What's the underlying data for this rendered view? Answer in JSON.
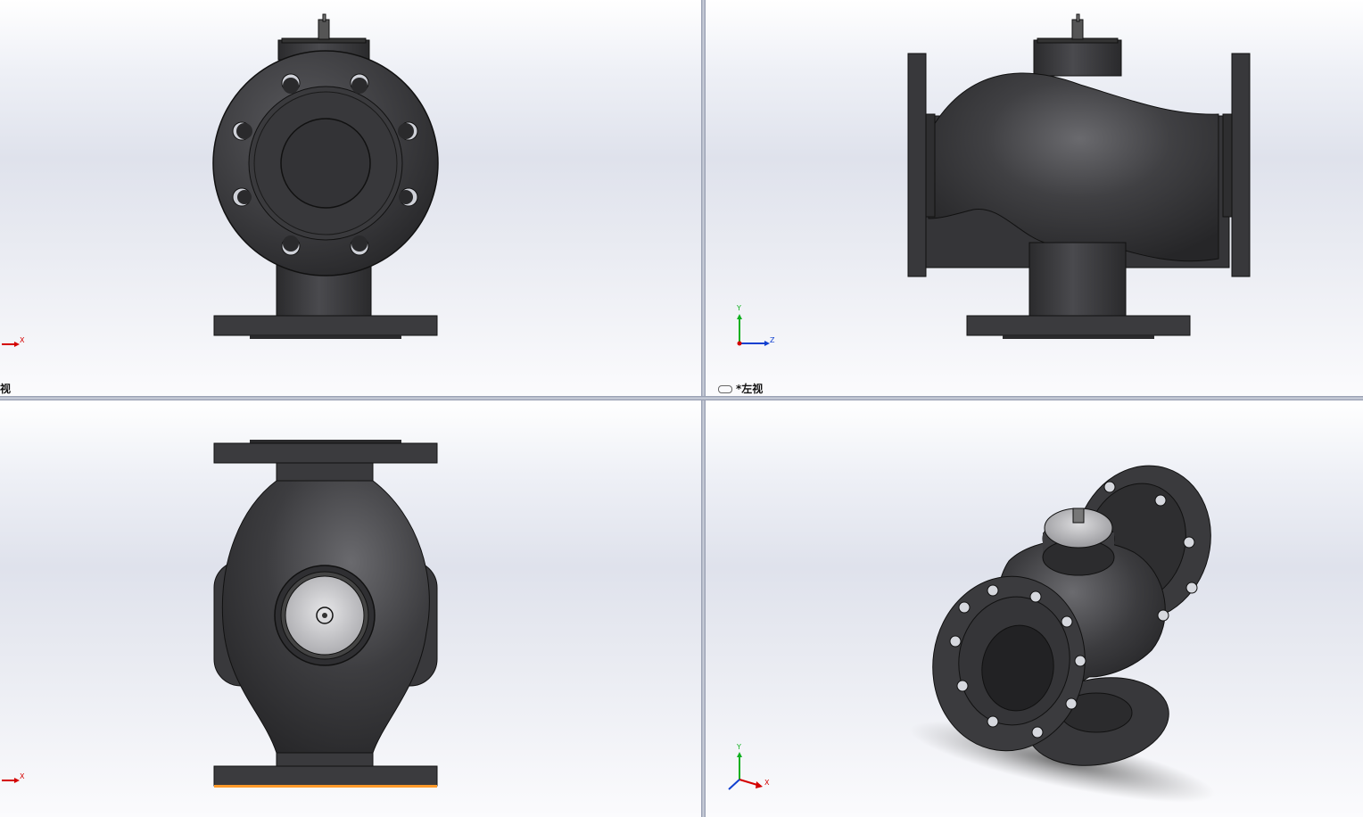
{
  "viewports": {
    "top_left": {
      "label": "视"
    },
    "top_right": {
      "label": "*左视",
      "triad": {
        "up": "Y",
        "right": "Z"
      }
    },
    "bottom_left": {},
    "bottom_right": {
      "triad": {
        "up": "Y",
        "right": "X"
      }
    }
  },
  "triads": {
    "top_left": {
      "right": "X"
    },
    "bottom_left": {
      "right": "X"
    }
  },
  "colors": {
    "body": "#3b3b3e",
    "axis_x": "#d40000",
    "axis_y": "#10b020",
    "axis_z": "#1040d0",
    "selection": "#ff9a2a"
  }
}
